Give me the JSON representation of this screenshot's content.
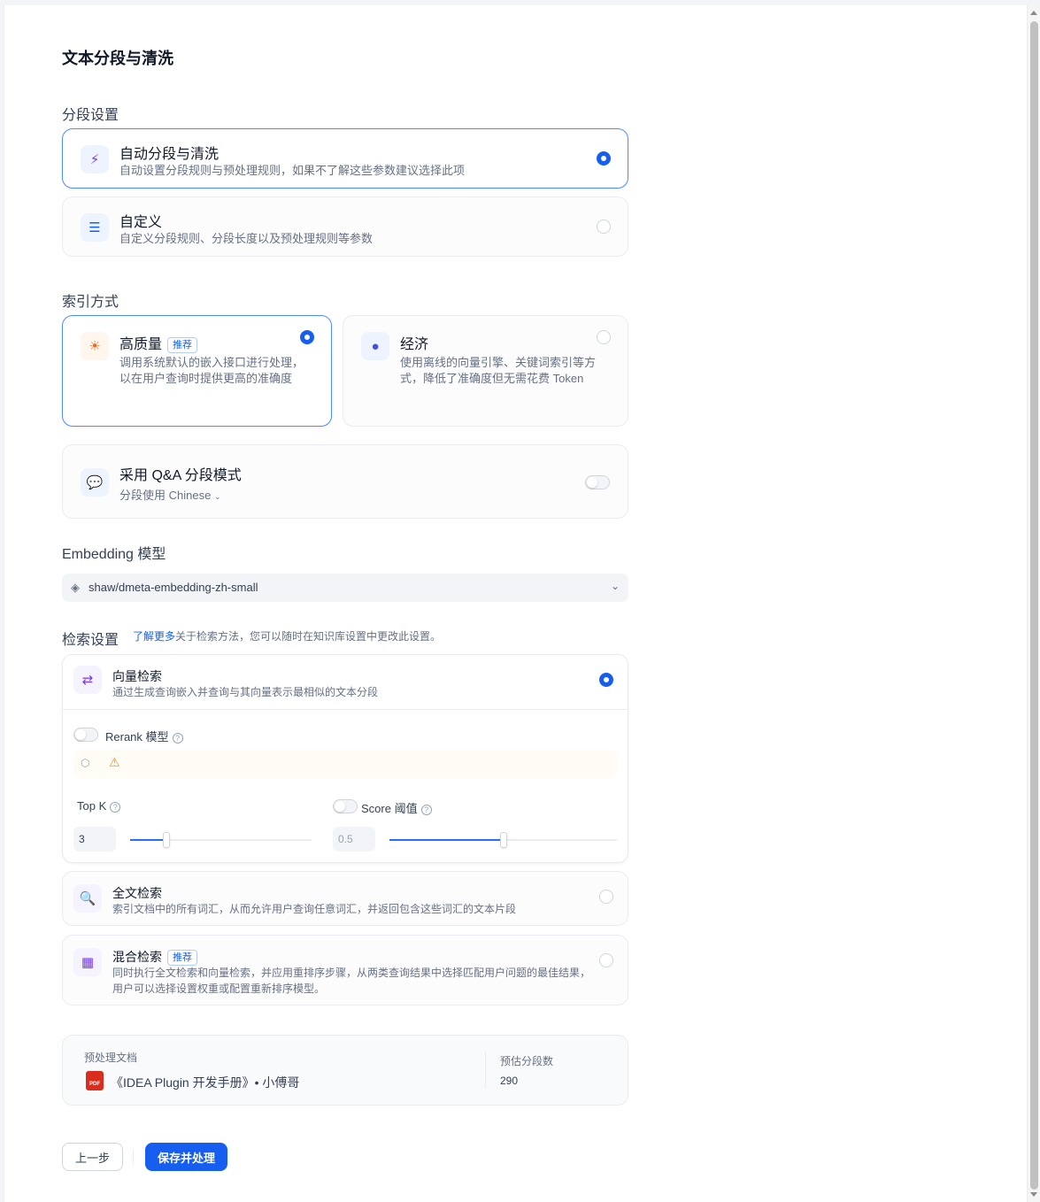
{
  "page_title": "文本分段与清洗",
  "segmentation": {
    "label": "分段设置",
    "auto": {
      "title": "自动分段与清洗",
      "desc": "自动设置分段规则与预处理规则，如果不了解这些参数建议选择此项"
    },
    "custom": {
      "title": "自定义",
      "desc": "自定义分段规则、分段长度以及预处理规则等参数"
    }
  },
  "index": {
    "label": "索引方式",
    "high": {
      "title": "高质量",
      "badge": "推荐",
      "desc1": "调用系统默认的嵌入接口进行处理，",
      "desc2": "以在用户查询时提供更高的准确度"
    },
    "eco": {
      "title": "经济",
      "desc1": "使用离线的向量引擎、关键词索引等方",
      "desc2": "式，降低了准确度但无需花费 Token"
    }
  },
  "qa": {
    "title": "采用 Q&A 分段模式",
    "lang_prefix": "分段使用",
    "lang": "Chinese"
  },
  "embedding": {
    "label": "Embedding 模型",
    "value": "shaw/dmeta-embedding-zh-small"
  },
  "retrieval": {
    "label": "检索设置",
    "link": "了解更多",
    "note": "关于检索方法，您可以随时在知识库设置中更改此设置。",
    "vector": {
      "title": "向量检索",
      "desc": "通过生成查询嵌入并查询与其向量表示最相似的文本分段"
    },
    "rerank_label": "Rerank 模型",
    "topk_label": "Top K",
    "topk_value": "3",
    "topk_level": 0.2,
    "score_label": "Score 阈值",
    "score_value": "0.5",
    "score_level": 0.5,
    "fulltext": {
      "title": "全文检索",
      "desc": "索引文档中的所有词汇，从而允许用户查询任意词汇，并返回包含这些词汇的文本片段"
    },
    "hybrid": {
      "title": "混合检索",
      "badge": "推荐",
      "desc1": "同时执行全文检索和向量检索，并应用重排序步骤，从两类查询结果中选择匹配用户问题的最佳结果，",
      "desc2": "用户可以选择设置权重或配置重新排序模型。"
    }
  },
  "preview": {
    "doc_label": "预处理文档",
    "doc_name": "《IDEA Plugin 开发手册》• 小傅哥",
    "pdf_label": "PDF",
    "count_label": "预估分段数",
    "count_value": "290"
  },
  "actions": {
    "back": "上一步",
    "save": "保存并处理"
  },
  "colors": {
    "accent": "#155eef",
    "border_active": "#528bff"
  }
}
